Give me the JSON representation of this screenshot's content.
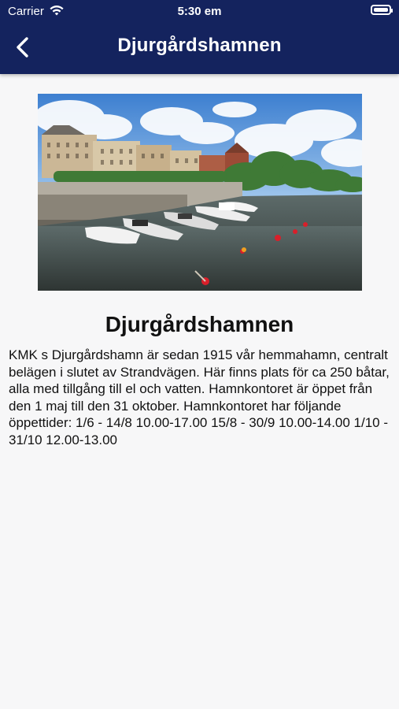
{
  "status_bar": {
    "carrier": "Carrier",
    "time": "5:30 em"
  },
  "nav": {
    "title": "Djurgårdshamnen",
    "back_icon": "chevron-left-icon"
  },
  "content": {
    "image": "harbor-photo",
    "heading": "Djurgårdshamnen",
    "description": "KMK s Djurgårdshamn är sedan 1915 vår hemmahamn, centralt belägen i slutet av Strandvägen. Här finns plats för ca 250 båtar, alla med tillgång till el och vatten. Hamnkontoret är öppet från den 1 maj till den 31 oktober. Hamnkontoret har följande öppettider: 1/6 - 14/8 10.00-17.00 15/8 - 30/9 10.00-14.00 1/10 - 31/10 12.00-13.00"
  },
  "colors": {
    "header": "#14235e",
    "background": "#f7f7f8"
  }
}
